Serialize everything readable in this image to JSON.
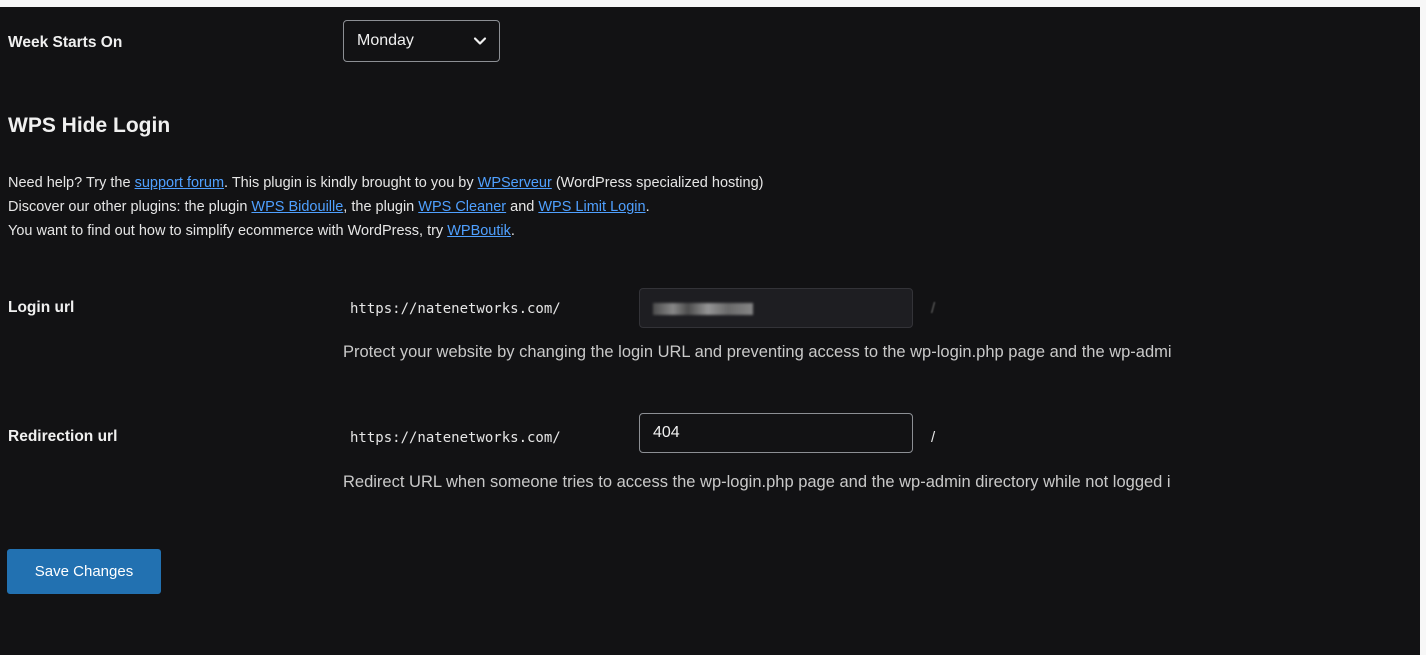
{
  "week_starts": {
    "label": "Week Starts On",
    "selected": "Monday"
  },
  "plugin": {
    "title": "WPS Hide Login",
    "line1": {
      "t1": "Need help? Try the ",
      "link_support": "support forum",
      "t2": ". This plugin is kindly brought to you by ",
      "link_wpserveur": "WPServeur",
      "t3": " (WordPress specialized hosting)"
    },
    "line2": {
      "t1": "Discover our other plugins: the plugin ",
      "link_bidouille": "WPS Bidouille",
      "t2": ", the plugin ",
      "link_cleaner": "WPS Cleaner",
      "t3": " and ",
      "link_limit": "WPS Limit Login",
      "t4": "."
    },
    "line3": {
      "t1": "You want to find out how to simplify ecommerce with WordPress, try ",
      "link_boutik": "WPBoutik",
      "t2": "."
    }
  },
  "login_url": {
    "label": "Login url",
    "prefix": "https://natenetworks.com/",
    "suffix": "/",
    "description": "Protect your website by changing the login URL and preventing access to the wp-login.php page and the wp-admi"
  },
  "redirection_url": {
    "label": "Redirection url",
    "prefix": "https://natenetworks.com/",
    "value": "404",
    "suffix": "/",
    "description": "Redirect URL when someone tries to access the wp-login.php page and the wp-admin directory while not logged i"
  },
  "save_button": {
    "label": "Save Changes"
  },
  "colors": {
    "background": "#121214",
    "link": "#4fa0ff",
    "button": "#2271b1"
  }
}
